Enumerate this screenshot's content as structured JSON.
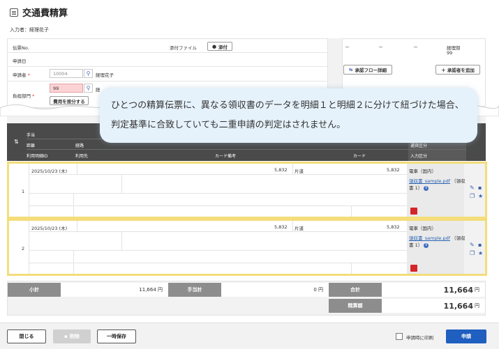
{
  "header": {
    "title": "交通費精算",
    "inputter": "入力者：経理花子"
  },
  "form": {
    "slip_no_label": "伝票No.",
    "apply_date_label": "申請日",
    "applicant_label": "申請者",
    "applicant_code": "10004",
    "applicant_name": "経理花子",
    "dept_label": "負担部門",
    "dept_code": "99",
    "dept_name": "経",
    "required_mark": "*",
    "prorate_button": "費用を按分する",
    "attachment_label": "添付ファイル",
    "attach_button": "添付"
  },
  "approval": {
    "cells": [
      "－",
      "－",
      "－"
    ],
    "dept": "経理部",
    "dept_code": "99",
    "flow_button": "承認フロー詳細",
    "add_button": "＋ 承認者を追加"
  },
  "notice": "ひとつの精算伝票に、異なる領収書のデータを明細１と明細２に分けて紐づけた場合、判定基準に合致していても二重申請の判定はされません。",
  "table_header": {
    "row1": "手当",
    "row2_a": "距離",
    "row2_b": "経路",
    "row3_a": "利用明細ID",
    "row3_b": "利用先",
    "row3_c": "カード備考",
    "row3_d": "カード",
    "right_1": "通貨区分",
    "right_2": "入力区分"
  },
  "details": [
    {
      "no": "1",
      "date": "2025/10/23 (木)",
      "amount": "5,832",
      "trip": "片道",
      "amount2": "5,832",
      "transport": "電車（国内）",
      "receipt_link": "領収書_sample.pdf",
      "receipt_suffix": "（領収書 1）"
    },
    {
      "no": "2",
      "date": "2025/10/23 (木)",
      "amount": "5,832",
      "trip": "片道",
      "amount2": "5,832",
      "transport": "電車（国内）",
      "receipt_link": "領収書_sample.pdf",
      "receipt_suffix": "（領収書 1）"
    }
  ],
  "totals": {
    "subtotal_label": "小計",
    "subtotal_value": "11,664 円",
    "allowance_label": "手当計",
    "allowance_value": "0 円",
    "total_label": "合計",
    "total_value": "11,664",
    "total_unit": "円",
    "settle_label": "精算額",
    "settle_value": "11,664",
    "settle_unit": "円"
  },
  "footer": {
    "close": "閉じる",
    "delete": "削除",
    "save": "一時保存",
    "print_label": "申請時に印刷",
    "submit": "申請"
  }
}
